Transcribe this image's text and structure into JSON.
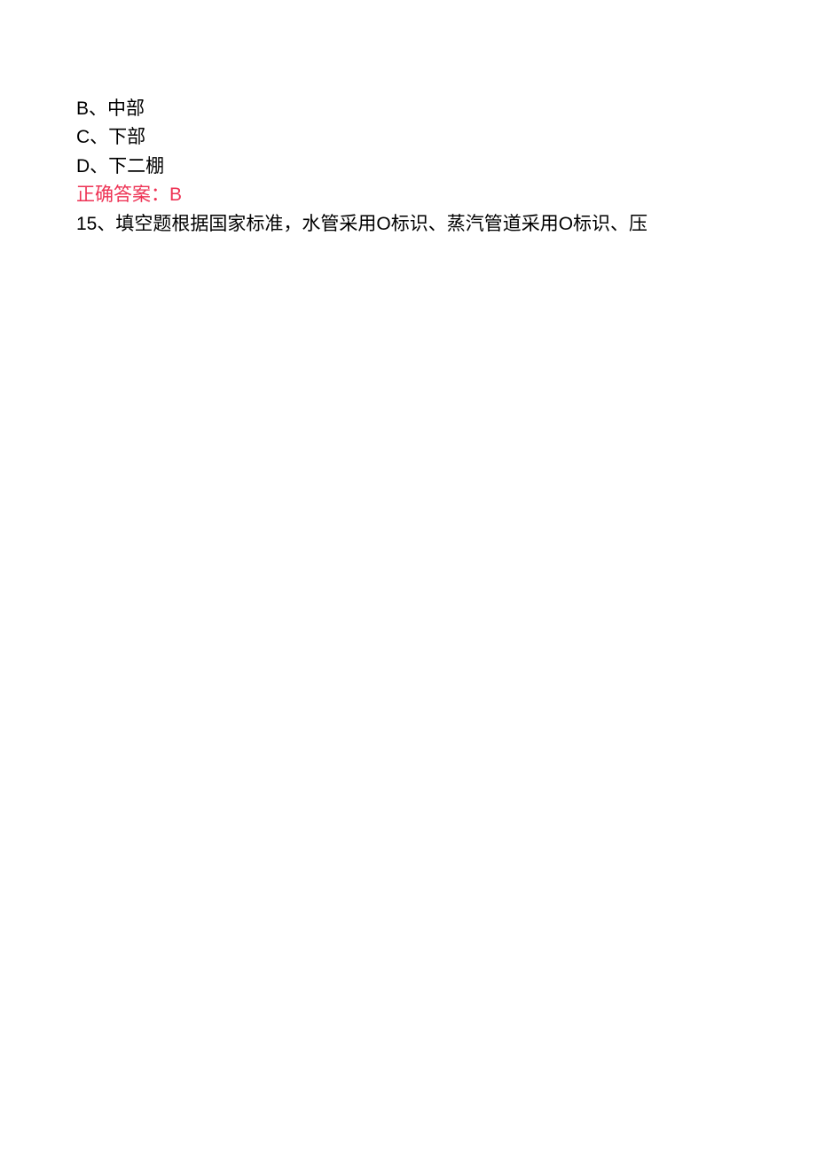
{
  "options": {
    "b": {
      "letter": "B",
      "separator": "、",
      "text": "中部"
    },
    "c": {
      "letter": "C",
      "separator": "、",
      "text": "下部"
    },
    "d": {
      "letter": "D",
      "separator": "、",
      "text": "下二棚"
    }
  },
  "answer": {
    "label": "正确答案：",
    "value": "B"
  },
  "question15": {
    "number": "15",
    "separator": "、",
    "text": "填空题根据国家标准，水管采用O标识、蒸汽管道采用O标识、压"
  }
}
